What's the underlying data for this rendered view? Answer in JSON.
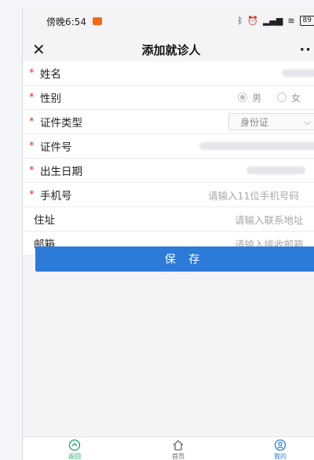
{
  "status_bar": {
    "time": "傍晚6:54",
    "battery": "89"
  },
  "header": {
    "title": "添加就诊人",
    "close_icon": "close-icon",
    "more_icon": "more-icon"
  },
  "form": {
    "fields": [
      {
        "label": "姓名",
        "required": true
      },
      {
        "label": "性别",
        "required": true,
        "options": [
          "男",
          "女"
        ],
        "selected": "男"
      },
      {
        "label": "证件类型",
        "required": true,
        "value": "身份证"
      },
      {
        "label": "证件号",
        "required": true
      },
      {
        "label": "出生日期",
        "required": true
      },
      {
        "label": "手机号",
        "required": true,
        "placeholder": "请输入11位手机号码"
      },
      {
        "label": "住址",
        "required": false,
        "placeholder": "请输入联系地址"
      },
      {
        "label": "邮箱",
        "required": false,
        "placeholder": "请输入接收邮箱"
      }
    ],
    "required_mark": "*",
    "save_label": "保 存"
  },
  "tabbar": {
    "items": [
      {
        "label": "返回"
      },
      {
        "label": "首页"
      },
      {
        "label": "我的"
      }
    ]
  },
  "colors": {
    "accent": "#2d7bd8",
    "required": "#e0322b",
    "back_tab": "#1aa36a"
  }
}
